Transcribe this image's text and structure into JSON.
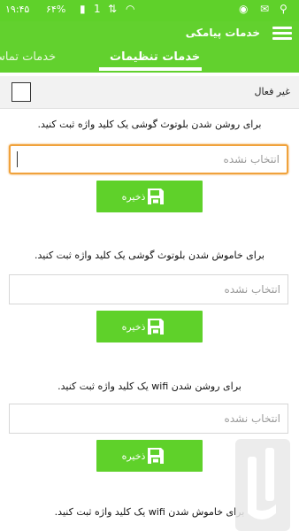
{
  "status_bar": {
    "time": "۱۹:۴۵",
    "battery": "۶۴%"
  },
  "app_bar": {
    "title": "خدمات پیامکی"
  },
  "tabs": [
    {
      "label": "خدمات تنظیمات",
      "active": true
    },
    {
      "label": "خدمات تماس",
      "active": false
    }
  ],
  "inactive_row": {
    "label": "غیر فعال"
  },
  "sections": [
    {
      "instruction": "برای روشن شدن بلوتوث گوشی یک کلید واژه ثبت کنید.",
      "input_placeholder": "انتخاب نشده",
      "save_label": "ذخیره"
    },
    {
      "instruction": "برای خاموش شدن بلوتوث گوشی یک کلید واژه ثبت کنید.",
      "input_placeholder": "انتخاب نشده",
      "save_label": "ذخیره"
    },
    {
      "instruction": "برای روشن شدن wifi یک کلید واژه ثبت کنید.",
      "input_placeholder": "انتخاب نشده",
      "save_label": "ذخیره"
    },
    {
      "instruction": "برای خاموش شدن wifi یک کلید واژه ثبت کنید."
    }
  ],
  "colors": {
    "accent_green": "#5fd12a",
    "focus_orange": "#f0a23c"
  }
}
